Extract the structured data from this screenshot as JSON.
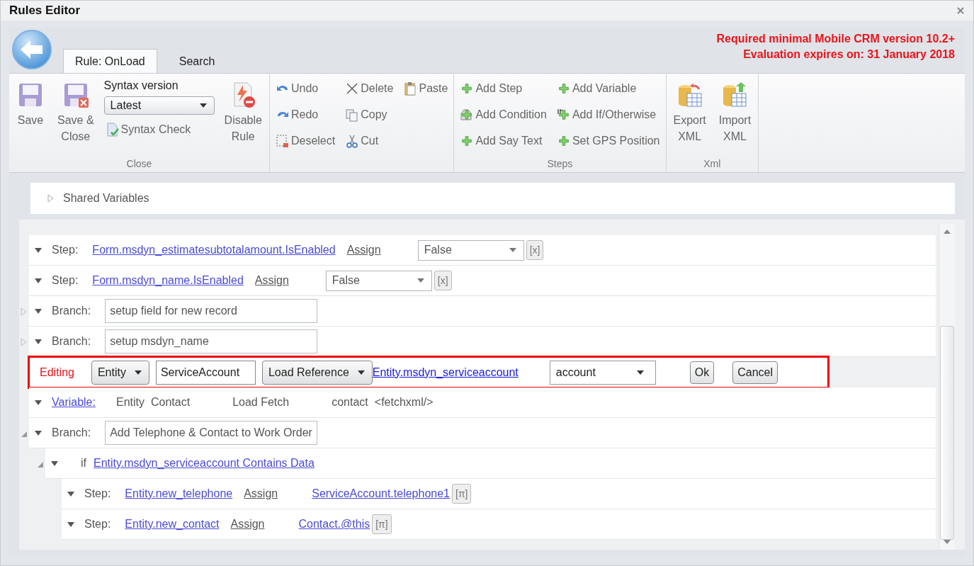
{
  "window": {
    "title": "Rules Editor"
  },
  "tabs": [
    {
      "label": "Rule: OnLoad",
      "selected": true
    },
    {
      "label": "Search",
      "selected": false
    }
  ],
  "notice": [
    "Required minimal Mobile CRM version 10.2+",
    "Evaluation expires on: 31 January 2018"
  ],
  "ribbon": {
    "groups": [
      {
        "label": "Close",
        "columns": [
          [
            {
              "kind": "large",
              "label": "Save"
            }
          ],
          [
            {
              "kind": "large",
              "label": "Save &\nClose"
            }
          ],
          [
            {
              "kind": "select",
              "label": "Syntax version",
              "value": "Latest"
            },
            {
              "kind": "small",
              "label": "Syntax Check"
            }
          ],
          [
            {
              "kind": "large",
              "label": "Disable\nRule"
            }
          ]
        ]
      },
      {
        "columns": [
          [
            {
              "kind": "small",
              "label": "Undo"
            },
            {
              "kind": "small",
              "label": "Redo"
            },
            {
              "kind": "small",
              "label": "Deselect"
            }
          ],
          [
            {
              "kind": "small",
              "label": "Delete"
            },
            {
              "kind": "small",
              "label": "Copy"
            },
            {
              "kind": "small",
              "label": "Cut"
            }
          ],
          [
            {
              "kind": "small",
              "label": "Paste"
            }
          ]
        ]
      },
      {
        "label": "Steps",
        "columns": [
          [
            {
              "kind": "small",
              "label": "Add Step"
            },
            {
              "kind": "small",
              "label": "Add Condition"
            },
            {
              "kind": "small",
              "label": "Add Say Text"
            }
          ],
          [
            {
              "kind": "small",
              "label": "Add Variable"
            },
            {
              "kind": "small",
              "label": "Add If/Otherwise"
            },
            {
              "kind": "small",
              "label": "Set GPS Position"
            }
          ]
        ]
      },
      {
        "label": "Xml",
        "columns": [
          [
            {
              "kind": "large",
              "label": "Export\nXML"
            }
          ],
          [
            {
              "kind": "large",
              "label": "Import\nXML"
            }
          ]
        ]
      }
    ]
  },
  "shared_variables": {
    "label": "Shared Variables",
    "expanded": false
  },
  "rules": [
    {
      "kind": "step",
      "label": "Step:",
      "target": "Form.msdyn_estimatesubtotalamount.IsEnabled",
      "operation": "Assign",
      "value": {
        "kind": "select",
        "text": "False"
      },
      "clear": "[x]"
    },
    {
      "kind": "step",
      "label": "Step:",
      "target": "Form.msdyn_name.IsEnabled",
      "operation": "Assign",
      "value": {
        "kind": "select",
        "text": "False"
      },
      "clear": "[x]"
    },
    {
      "kind": "branch",
      "label": "Branch:",
      "name": "setup field for new record",
      "expanded": false
    },
    {
      "kind": "branch",
      "label": "Branch:",
      "name": "setup msdyn_name",
      "expanded": false
    },
    {
      "kind": "editing",
      "label": "Editing",
      "highlighted": true,
      "type": "Entity",
      "name": "ServiceAccount",
      "mode": "Load Reference",
      "target": "Entity.msdyn_serviceaccount",
      "entity": "account",
      "buttons": [
        "Ok",
        "Cancel"
      ]
    },
    {
      "kind": "variable",
      "link": "Variable:",
      "parts": [
        "Entity",
        "Contact",
        "Load Fetch",
        "contact",
        "<fetchxml/>"
      ]
    },
    {
      "kind": "branch",
      "label": "Branch:",
      "name": "Add Telephone & Contact to Work Order",
      "expanded": true,
      "children": [
        {
          "kind": "if",
          "keyword": "if",
          "condition": "Entity.msdyn_serviceaccount Contains Data",
          "expanded": true,
          "children": [
            {
              "kind": "step",
              "label": "Step:",
              "target": "Entity.new_telephone",
              "operation": "Assign",
              "value": {
                "kind": "link",
                "text": "ServiceAccount.telephone1"
              },
              "clear": "[π]"
            },
            {
              "kind": "step",
              "label": "Step:",
              "target": "Entity.new_contact",
              "operation": "Assign",
              "value": {
                "kind": "link",
                "text": "Contact.@this"
              },
              "clear": "[π]"
            }
          ]
        }
      ]
    }
  ]
}
